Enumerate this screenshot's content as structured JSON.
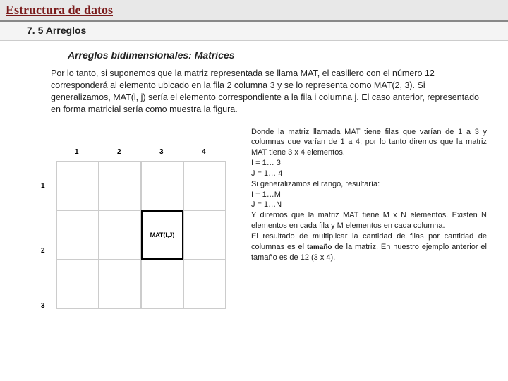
{
  "header": {
    "title": "Estructura de datos",
    "subtitle": "7. 5 Arreglos"
  },
  "section_heading": "Arreglos bidimensionales: Matrices",
  "intro": "Por lo tanto, si suponemos que la matriz representada se llama MAT, el casillero con el número 12 corresponderá al elemento ubicado en la fila 2 columna 3 y se lo representa como MAT(2, 3). Si generalizamos, MAT(i, j) sería el elemento correspondiente a la fila i columna j. El caso anterior, representado en forma matricial sería como muestra la figura.",
  "figure": {
    "cols": [
      "1",
      "2",
      "3",
      "4"
    ],
    "rows": [
      "1",
      "2",
      "3"
    ],
    "highlight_label": "MAT(I,J)"
  },
  "right": {
    "p1": "Donde la matriz llamada MAT tiene filas que varían de 1 a 3 y columnas que varían de 1 a 4, por lo tanto diremos que la matriz MAT tiene 3 x 4 elementos.",
    "l1": "I = 1… 3",
    "l2": "J = 1… 4",
    "p2": "Si generalizamos el rango, resultaría:",
    "l3": "I = 1…M",
    "l4": "J = 1…N",
    "p3": "Y diremos que la matriz MAT tiene M x N elementos. Existen N elementos en cada fila y M elementos en cada columna.",
    "p4a": "El resultado de multiplicar la cantidad de filas por cantidad de columnas es el ",
    "p4b": "tamaño",
    "p4c": " de la matriz. En nuestro ejemplo anterior el tamaño es de 12 (3 x 4)."
  }
}
